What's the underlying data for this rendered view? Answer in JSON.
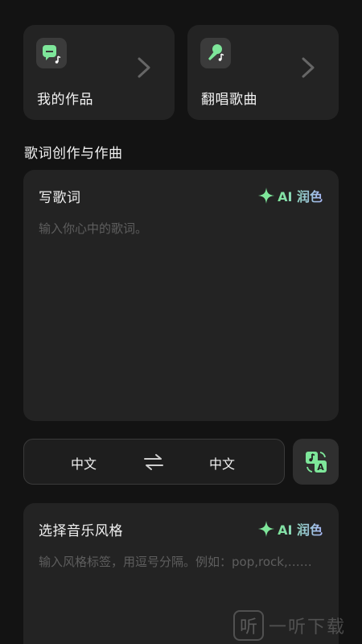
{
  "shortcuts": {
    "my_works": {
      "label": "我的作品",
      "icon": "works-icon"
    },
    "cover_songs": {
      "label": "翻唱歌曲",
      "icon": "microphone-icon"
    }
  },
  "section": {
    "title": "歌词创作与作曲"
  },
  "lyrics": {
    "title": "写歌词",
    "ai_label": "AI 润色",
    "placeholder": "输入你心中的歌词。"
  },
  "language": {
    "source": "中文",
    "target": "中文",
    "swap_icon": "swap-arrows-icon",
    "translate_icon": "translate-icon"
  },
  "style": {
    "title": "选择音乐风格",
    "ai_label": "AI 润色",
    "placeholder": "输入风格标签，用逗号分隔。例如：pop,rock,……"
  },
  "watermark": {
    "text": "一听下载",
    "glyph": "听"
  },
  "colors": {
    "background": "#131313",
    "card": "#232323",
    "accent_green": "#7ee69a",
    "accent_purple": "#a7b7f4",
    "placeholder": "#5e5e5e"
  }
}
